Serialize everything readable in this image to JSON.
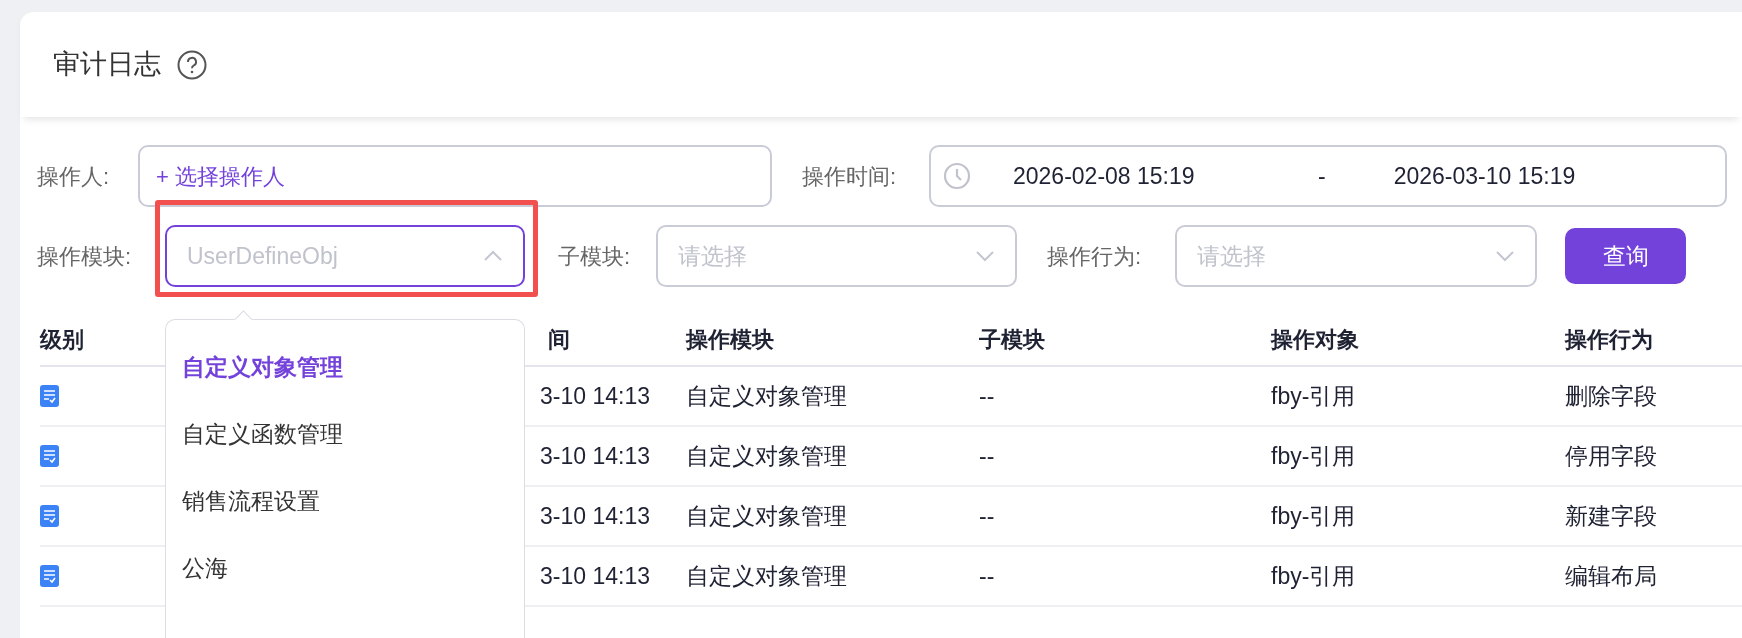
{
  "page": {
    "title": "审计日志"
  },
  "filters": {
    "operator": {
      "label": "操作人:",
      "action": "+ 选择操作人"
    },
    "time": {
      "label": "操作时间:",
      "start": "2026-02-08 15:19",
      "separator": "-",
      "end": "2026-03-10 15:19"
    },
    "module": {
      "label": "操作模块:",
      "placeholder": "UserDefineObj",
      "expanded": true,
      "highlighted": true,
      "options": [
        {
          "label": "自定义对象管理",
          "selected": true
        },
        {
          "label": "自定义函数管理",
          "selected": false
        },
        {
          "label": "销售流程设置",
          "selected": false
        },
        {
          "label": "公海",
          "selected": false
        }
      ]
    },
    "submodule": {
      "label": "子模块:",
      "placeholder": "请选择",
      "expanded": false
    },
    "behavior": {
      "label": "操作行为:",
      "placeholder": "请选择",
      "expanded": false
    },
    "query_button": "查询"
  },
  "table": {
    "columns": [
      "级别",
      "间",
      "操作模块",
      "子模块",
      "操作对象",
      "操作行为"
    ],
    "rows": [
      {
        "time": "3-10 14:13",
        "module": "自定义对象管理",
        "submodule": "--",
        "object": "fby-引用",
        "action": "删除字段"
      },
      {
        "time": "3-10 14:13",
        "module": "自定义对象管理",
        "submodule": "--",
        "object": "fby-引用",
        "action": "停用字段"
      },
      {
        "time": "3-10 14:13",
        "module": "自定义对象管理",
        "submodule": "--",
        "object": "fby-引用",
        "action": "新建字段"
      },
      {
        "time": "3-10 14:13",
        "module": "自定义对象管理",
        "submodule": "--",
        "object": "fby-引用",
        "action": "编辑布局"
      }
    ]
  }
}
